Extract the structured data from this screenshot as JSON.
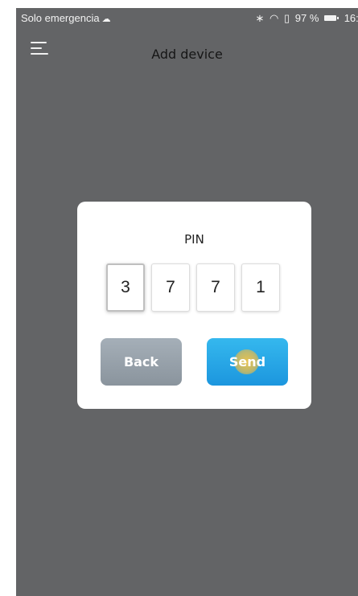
{
  "status_bar": {
    "carrier": "Solo emergencia",
    "cloud_icon": "cloud-icon",
    "bluetooth_icon": "bluetooth-icon",
    "wifi_icon": "wifi-icon",
    "battery_percent": "97 %",
    "time": "16:5"
  },
  "app_bar": {
    "menu_icon": "hamburger-menu-icon",
    "title": "Add device"
  },
  "dialog": {
    "title": "PIN",
    "pin_digits": [
      "3",
      "7",
      "7",
      "1"
    ],
    "back_label": "Back",
    "send_label": "Send"
  },
  "colors": {
    "screen_background": "#636466",
    "dialog_background": "#ffffff",
    "back_button": "#95a0a9",
    "send_button": "#26a7e6",
    "touch_indicator": "#f4c446"
  }
}
